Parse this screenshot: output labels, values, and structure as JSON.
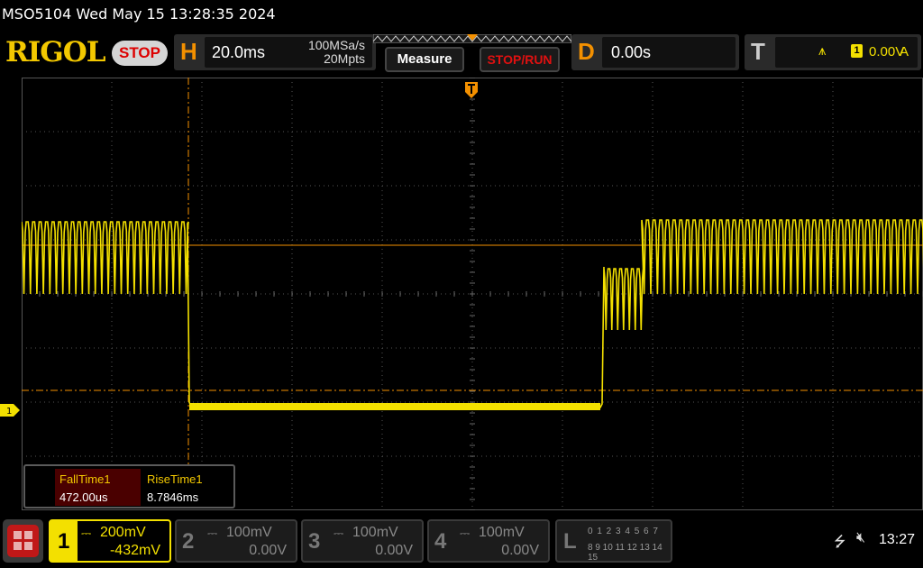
{
  "window": {
    "title": "MSO5104  Wed May 15 13:28:35 2024"
  },
  "header": {
    "logo": "RIGOL",
    "run_state": "STOP",
    "horizontal": {
      "letter": "H",
      "timebase": "20.0ms",
      "sample_rate": "100MSa/s",
      "memory_depth": "20Mpts"
    },
    "measure_label": "Measure",
    "stop_run_label": "STOP/RUN",
    "delay": {
      "letter": "D",
      "value": "0.00s"
    },
    "trigger": {
      "letter": "T",
      "slope_icon": "rising-edge-icon",
      "channel": "1",
      "level": "0.00V",
      "mode": "A"
    }
  },
  "measurements": [
    {
      "name": "FallTime1",
      "value": "472.00us"
    },
    {
      "name": "RiseTime1",
      "value": "8.7846ms"
    }
  ],
  "channels": [
    {
      "num": "1",
      "scale": "200mV",
      "offset": "-432mV",
      "active": true
    },
    {
      "num": "2",
      "scale": "100mV",
      "offset": "0.00V",
      "active": false
    },
    {
      "num": "3",
      "scale": "100mV",
      "offset": "0.00V",
      "active": false
    },
    {
      "num": "4",
      "scale": "100mV",
      "offset": "0.00V",
      "active": false
    }
  ],
  "logic": {
    "letter": "L",
    "row1": "0 1 2 3  4 5 6 7",
    "row2": "8 9 10 11 12 13 14 15"
  },
  "ch1_marker": "1",
  "status": {
    "clock": "13:27"
  },
  "colors": {
    "ch1": "#f3e000",
    "cursor": "#f39000",
    "accent": "#f3c800"
  }
}
